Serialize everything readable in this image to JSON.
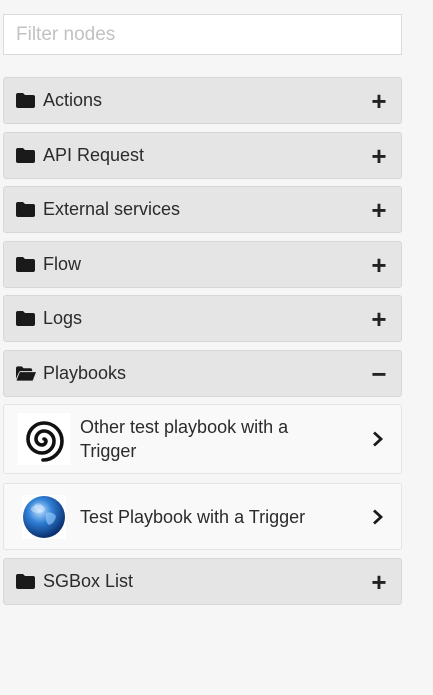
{
  "filter": {
    "placeholder": "Filter nodes",
    "value": ""
  },
  "categories": [
    {
      "label": "Actions",
      "state": "collapsed",
      "toggle": "+"
    },
    {
      "label": "API Request",
      "state": "collapsed",
      "toggle": "+"
    },
    {
      "label": "External services",
      "state": "collapsed",
      "toggle": "+"
    },
    {
      "label": "Flow",
      "state": "collapsed",
      "toggle": "+"
    },
    {
      "label": "Logs",
      "state": "collapsed",
      "toggle": "+"
    },
    {
      "label": "Playbooks",
      "state": "expanded",
      "toggle": "−"
    },
    {
      "label": "SGBox List",
      "state": "collapsed",
      "toggle": "+"
    }
  ],
  "playbooks": {
    "items": [
      {
        "label": "Other test playbook with a Trigger",
        "icon": "spiral-icon"
      },
      {
        "label": "Test Playbook with a Trigger",
        "icon": "globe-icon"
      }
    ]
  },
  "colors": {
    "background": "#f6f6f6",
    "category_bg": "#e5e5e5",
    "item_bg": "#f9f9f9",
    "text": "#2b2b2b"
  }
}
